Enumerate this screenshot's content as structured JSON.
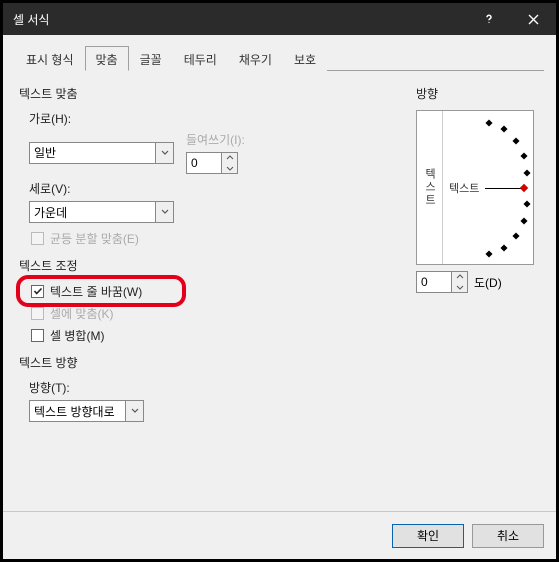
{
  "title": "셀 서식",
  "tabs": [
    "표시 형식",
    "맞춤",
    "글꼴",
    "테두리",
    "채우기",
    "보호"
  ],
  "active_tab": 1,
  "text_align": {
    "group": "텍스트 맞춤",
    "h_label": "가로(H):",
    "h_value": "일반",
    "v_label": "세로(V):",
    "v_value": "가운데",
    "indent_label": "들여쓰기(I):",
    "indent_value": "0",
    "equal_split": "균등 분할 맞춤(E)"
  },
  "text_control": {
    "group": "텍스트 조정",
    "wrap": "텍스트 줄 바꿈(W)",
    "shrink": "셀에 맞춤(K)",
    "merge": "셀 병합(M)"
  },
  "text_dir": {
    "group": "텍스트 방향",
    "label": "방향(T):",
    "value": "텍스트 방향대로"
  },
  "orient": {
    "group": "방향",
    "vlabel": "텍스트",
    "hlabel": "텍스트",
    "deg_value": "0",
    "deg_label": "도(D)"
  },
  "buttons": {
    "ok": "확인",
    "cancel": "취소"
  }
}
